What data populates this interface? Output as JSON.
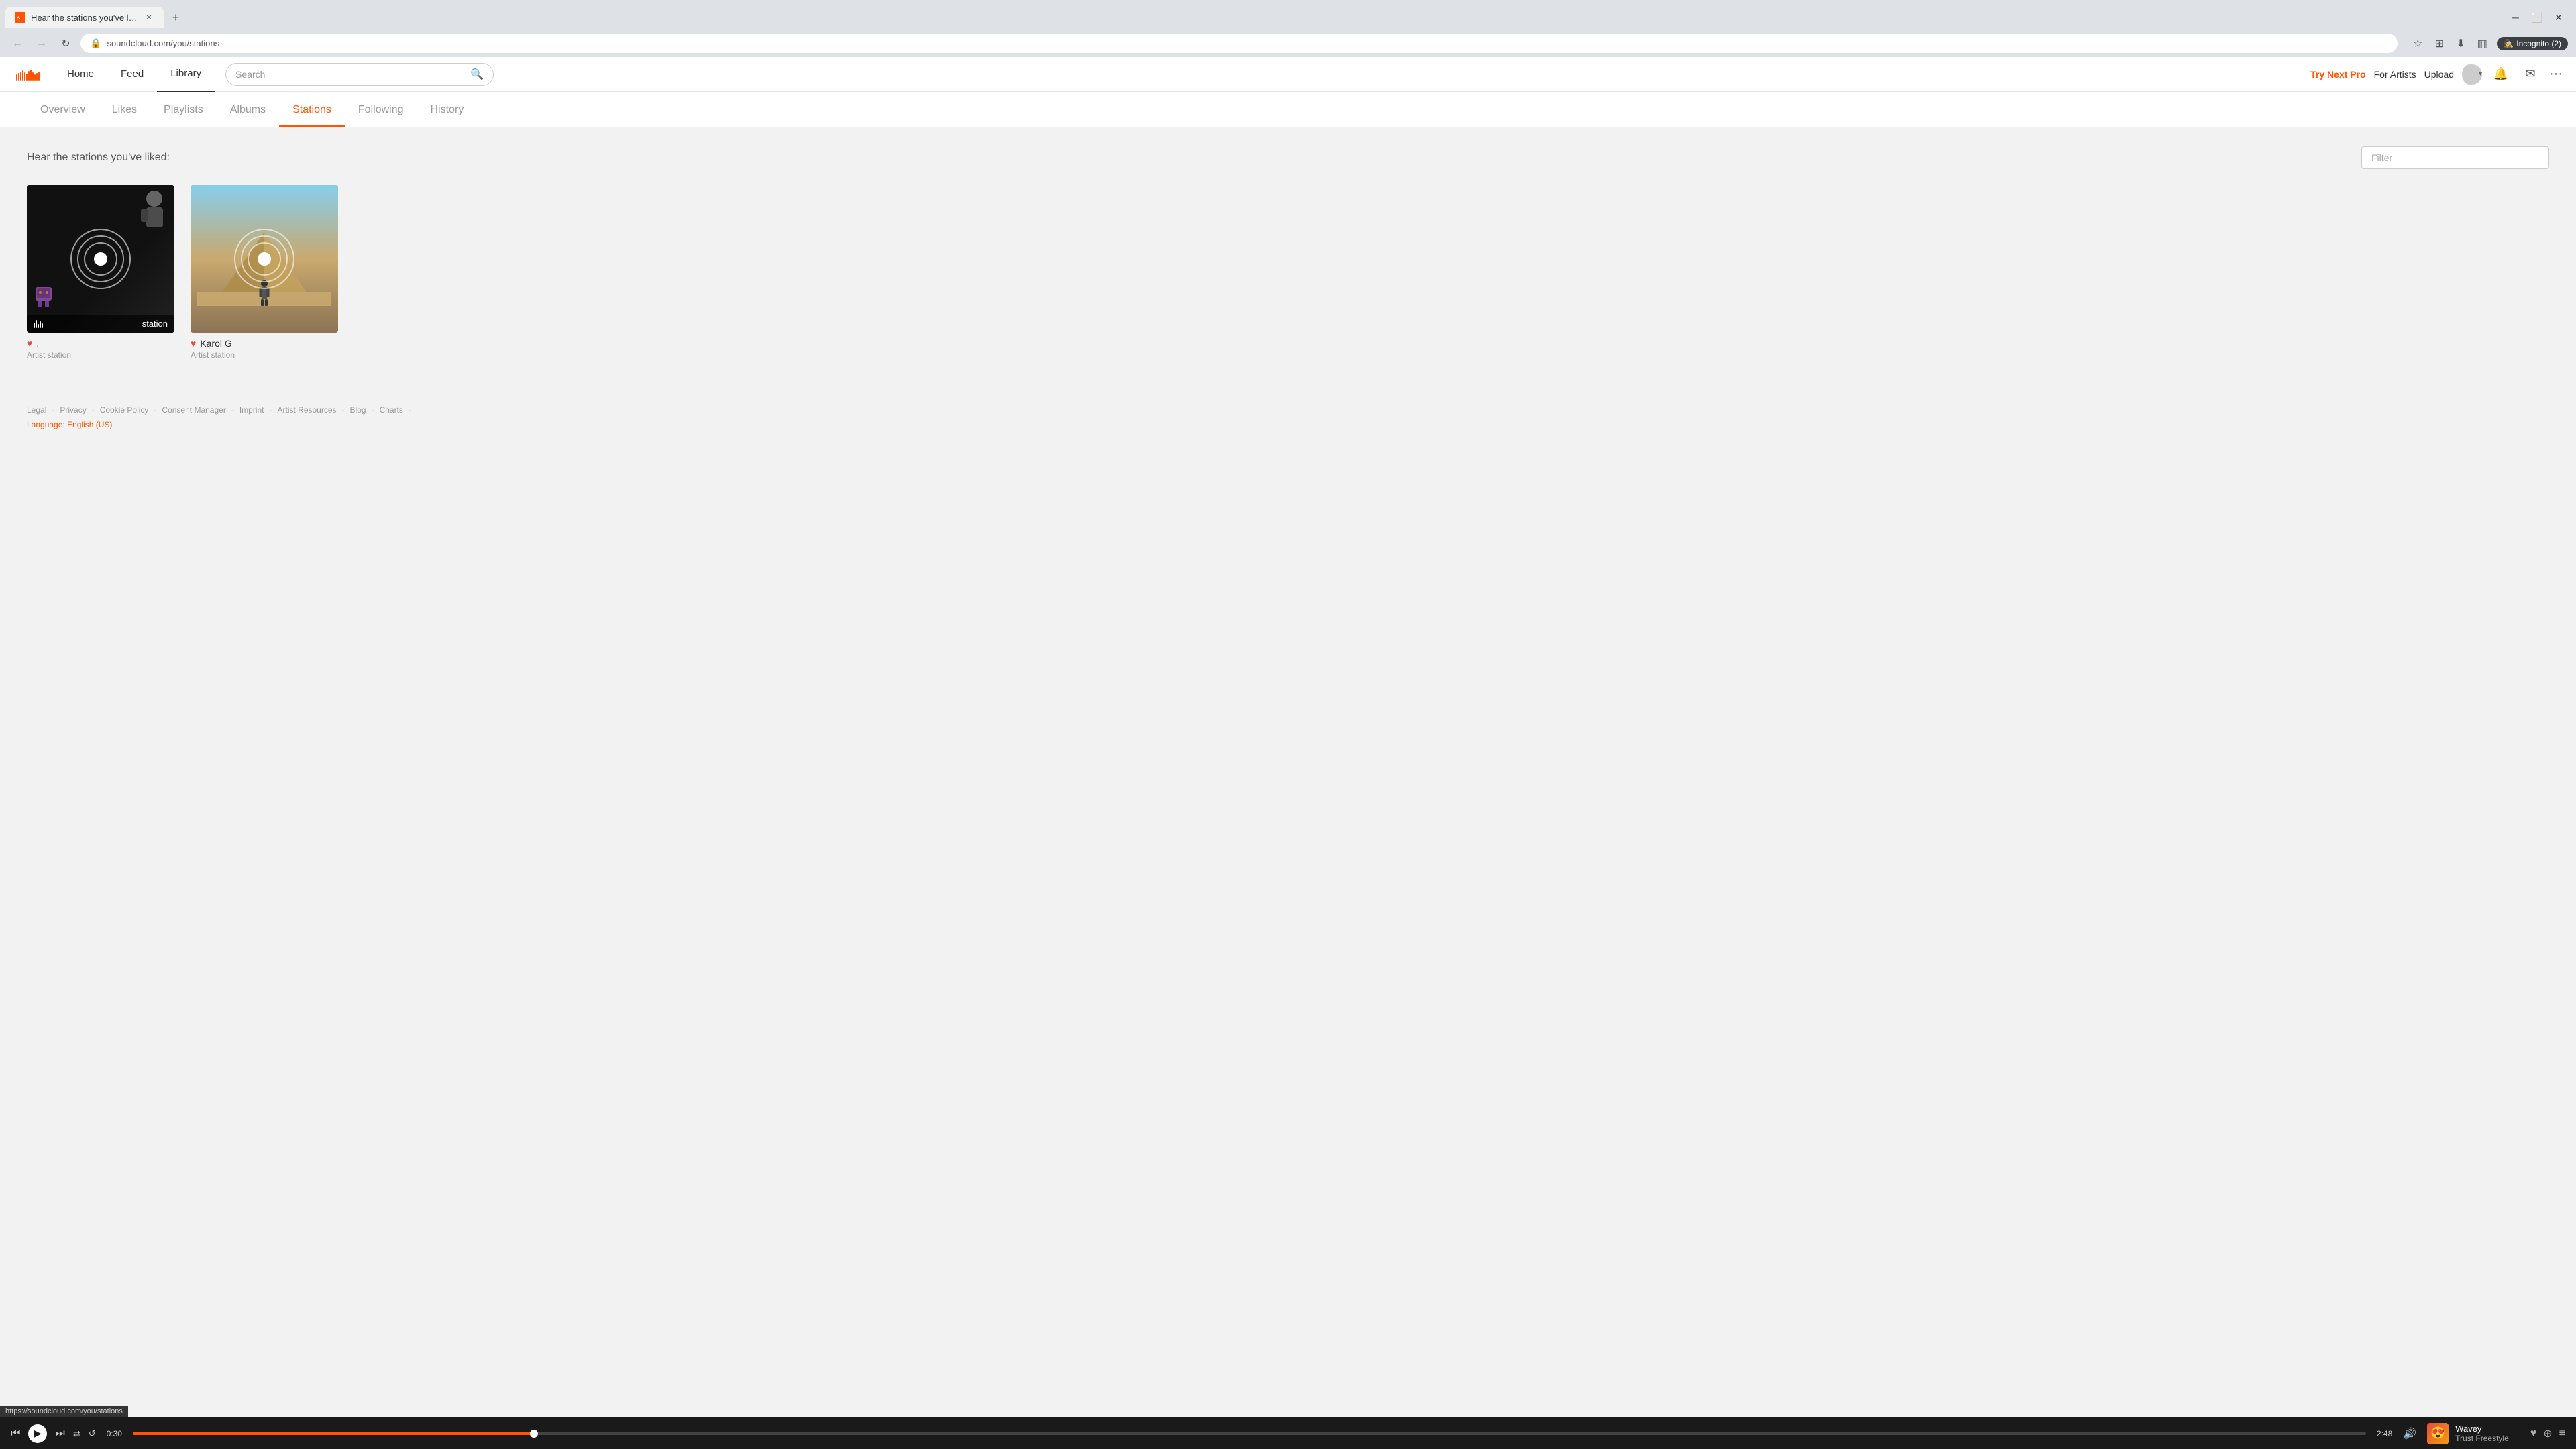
{
  "browser": {
    "tab_title": "Hear the stations you've liked: ...",
    "tab_favicon": "SC",
    "url": "soundcloud.com/you/stations",
    "incognito_label": "Incognito (2)"
  },
  "topnav": {
    "home_label": "Home",
    "feed_label": "Feed",
    "library_label": "Library",
    "search_placeholder": "Search",
    "try_pro_label": "Try Next Pro",
    "for_artists_label": "For Artists",
    "upload_label": "Upload"
  },
  "library_tabs": [
    {
      "id": "overview",
      "label": "Overview"
    },
    {
      "id": "likes",
      "label": "Likes"
    },
    {
      "id": "playlists",
      "label": "Playlists"
    },
    {
      "id": "albums",
      "label": "Albums"
    },
    {
      "id": "stations",
      "label": "Stations"
    },
    {
      "id": "following",
      "label": "Following"
    },
    {
      "id": "history",
      "label": "History"
    }
  ],
  "stations_page": {
    "section_title": "Hear the stations you've liked:",
    "filter_placeholder": "Filter"
  },
  "stations": [
    {
      "id": "station-1",
      "name": ".",
      "type": "Artist station",
      "label": "station",
      "bg_type": "dark_character"
    },
    {
      "id": "station-2",
      "name": "Karol G",
      "type": "Artist station",
      "bg_type": "pyramid_photo"
    }
  ],
  "footer": {
    "links": [
      "Legal",
      "Privacy",
      "Cookie Policy",
      "Consent Manager",
      "Imprint",
      "Artist Resources",
      "Blog",
      "Charts"
    ],
    "language_label": "Language: English (US)"
  },
  "player": {
    "current_time": "0:30",
    "total_time": "2:48",
    "track_title": "Wavey",
    "track_artist": "Trust Freestyle",
    "progress_percent": 18
  },
  "status_bar": {
    "url": "https://soundcloud.com/you/stations"
  }
}
